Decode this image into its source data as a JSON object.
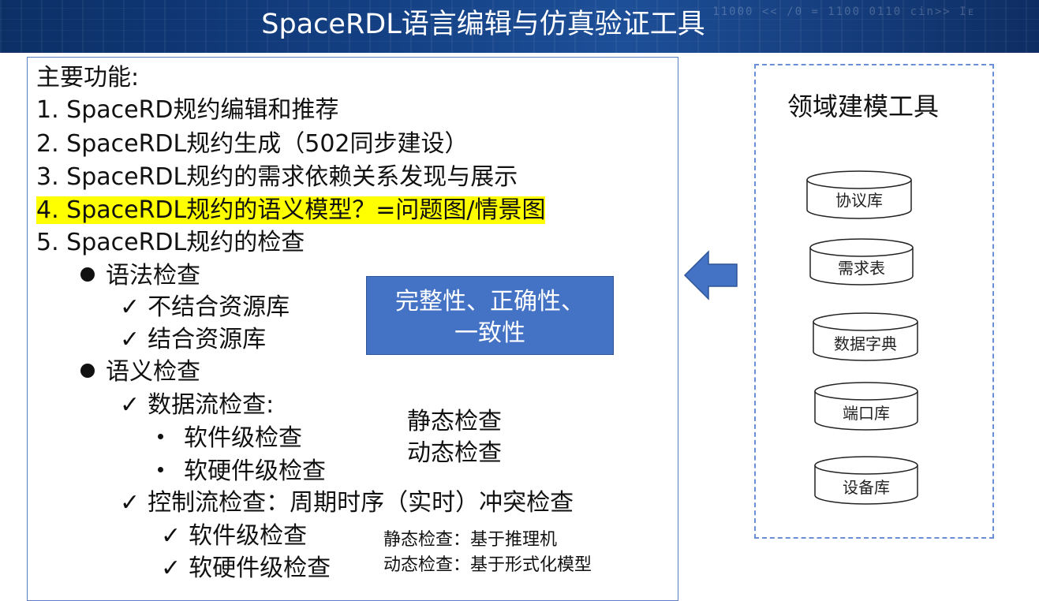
{
  "header": {
    "title": "SpaceRDL语言编辑与仿真验证工具",
    "decor_text": "11000  <<  /0 =  \n 1100 0110 cin>> Iᴇ"
  },
  "main": {
    "heading": "主要功能:",
    "items": [
      "1. SpaceRD规约编辑和推荐",
      "2. SpaceRDL规约生成（502同步建设）",
      "3. SpaceRDL规约的需求依赖关系发现与展示",
      "4. SpaceRDL规约的语义模型？=问题图/情景图",
      "5. SpaceRDL规约的检查"
    ],
    "syntax_check": {
      "label": "语法检查",
      "children": [
        "不结合资源库",
        "结合资源库"
      ]
    },
    "semantic_check": {
      "label": "语义检查",
      "dataflow": {
        "label": "数据流检查:",
        "children": [
          "软件级检查",
          "软硬件级检查"
        ]
      },
      "controlflow": {
        "label": "控制流检查：周期时序（实时）冲突检查",
        "children": [
          "软件级检查",
          "软硬件级检查"
        ]
      }
    },
    "dataflow_notes": [
      "静态检查",
      "动态检查"
    ],
    "controlflow_notes": [
      "静态检查：基于推理机",
      "动态检查：基于形式化模型"
    ],
    "blue_box": [
      "完整性、正确性、",
      "一致性"
    ]
  },
  "side_panel": {
    "title": "领域建模工具",
    "libraries": [
      "协议库",
      "需求表",
      "数据字典",
      "端口库",
      "设备库"
    ]
  },
  "colors": {
    "banner": "#133f82",
    "highlight": "#ffff00",
    "box_fill": "#4472c4",
    "arrow": "#4472c4",
    "panel_border": "#6b8fd6"
  },
  "icons": {
    "arrow": "left-arrow-icon",
    "bullet": "filled-circle-bullet",
    "check": "checkmark-icon",
    "library": "database-cylinder-icon"
  }
}
